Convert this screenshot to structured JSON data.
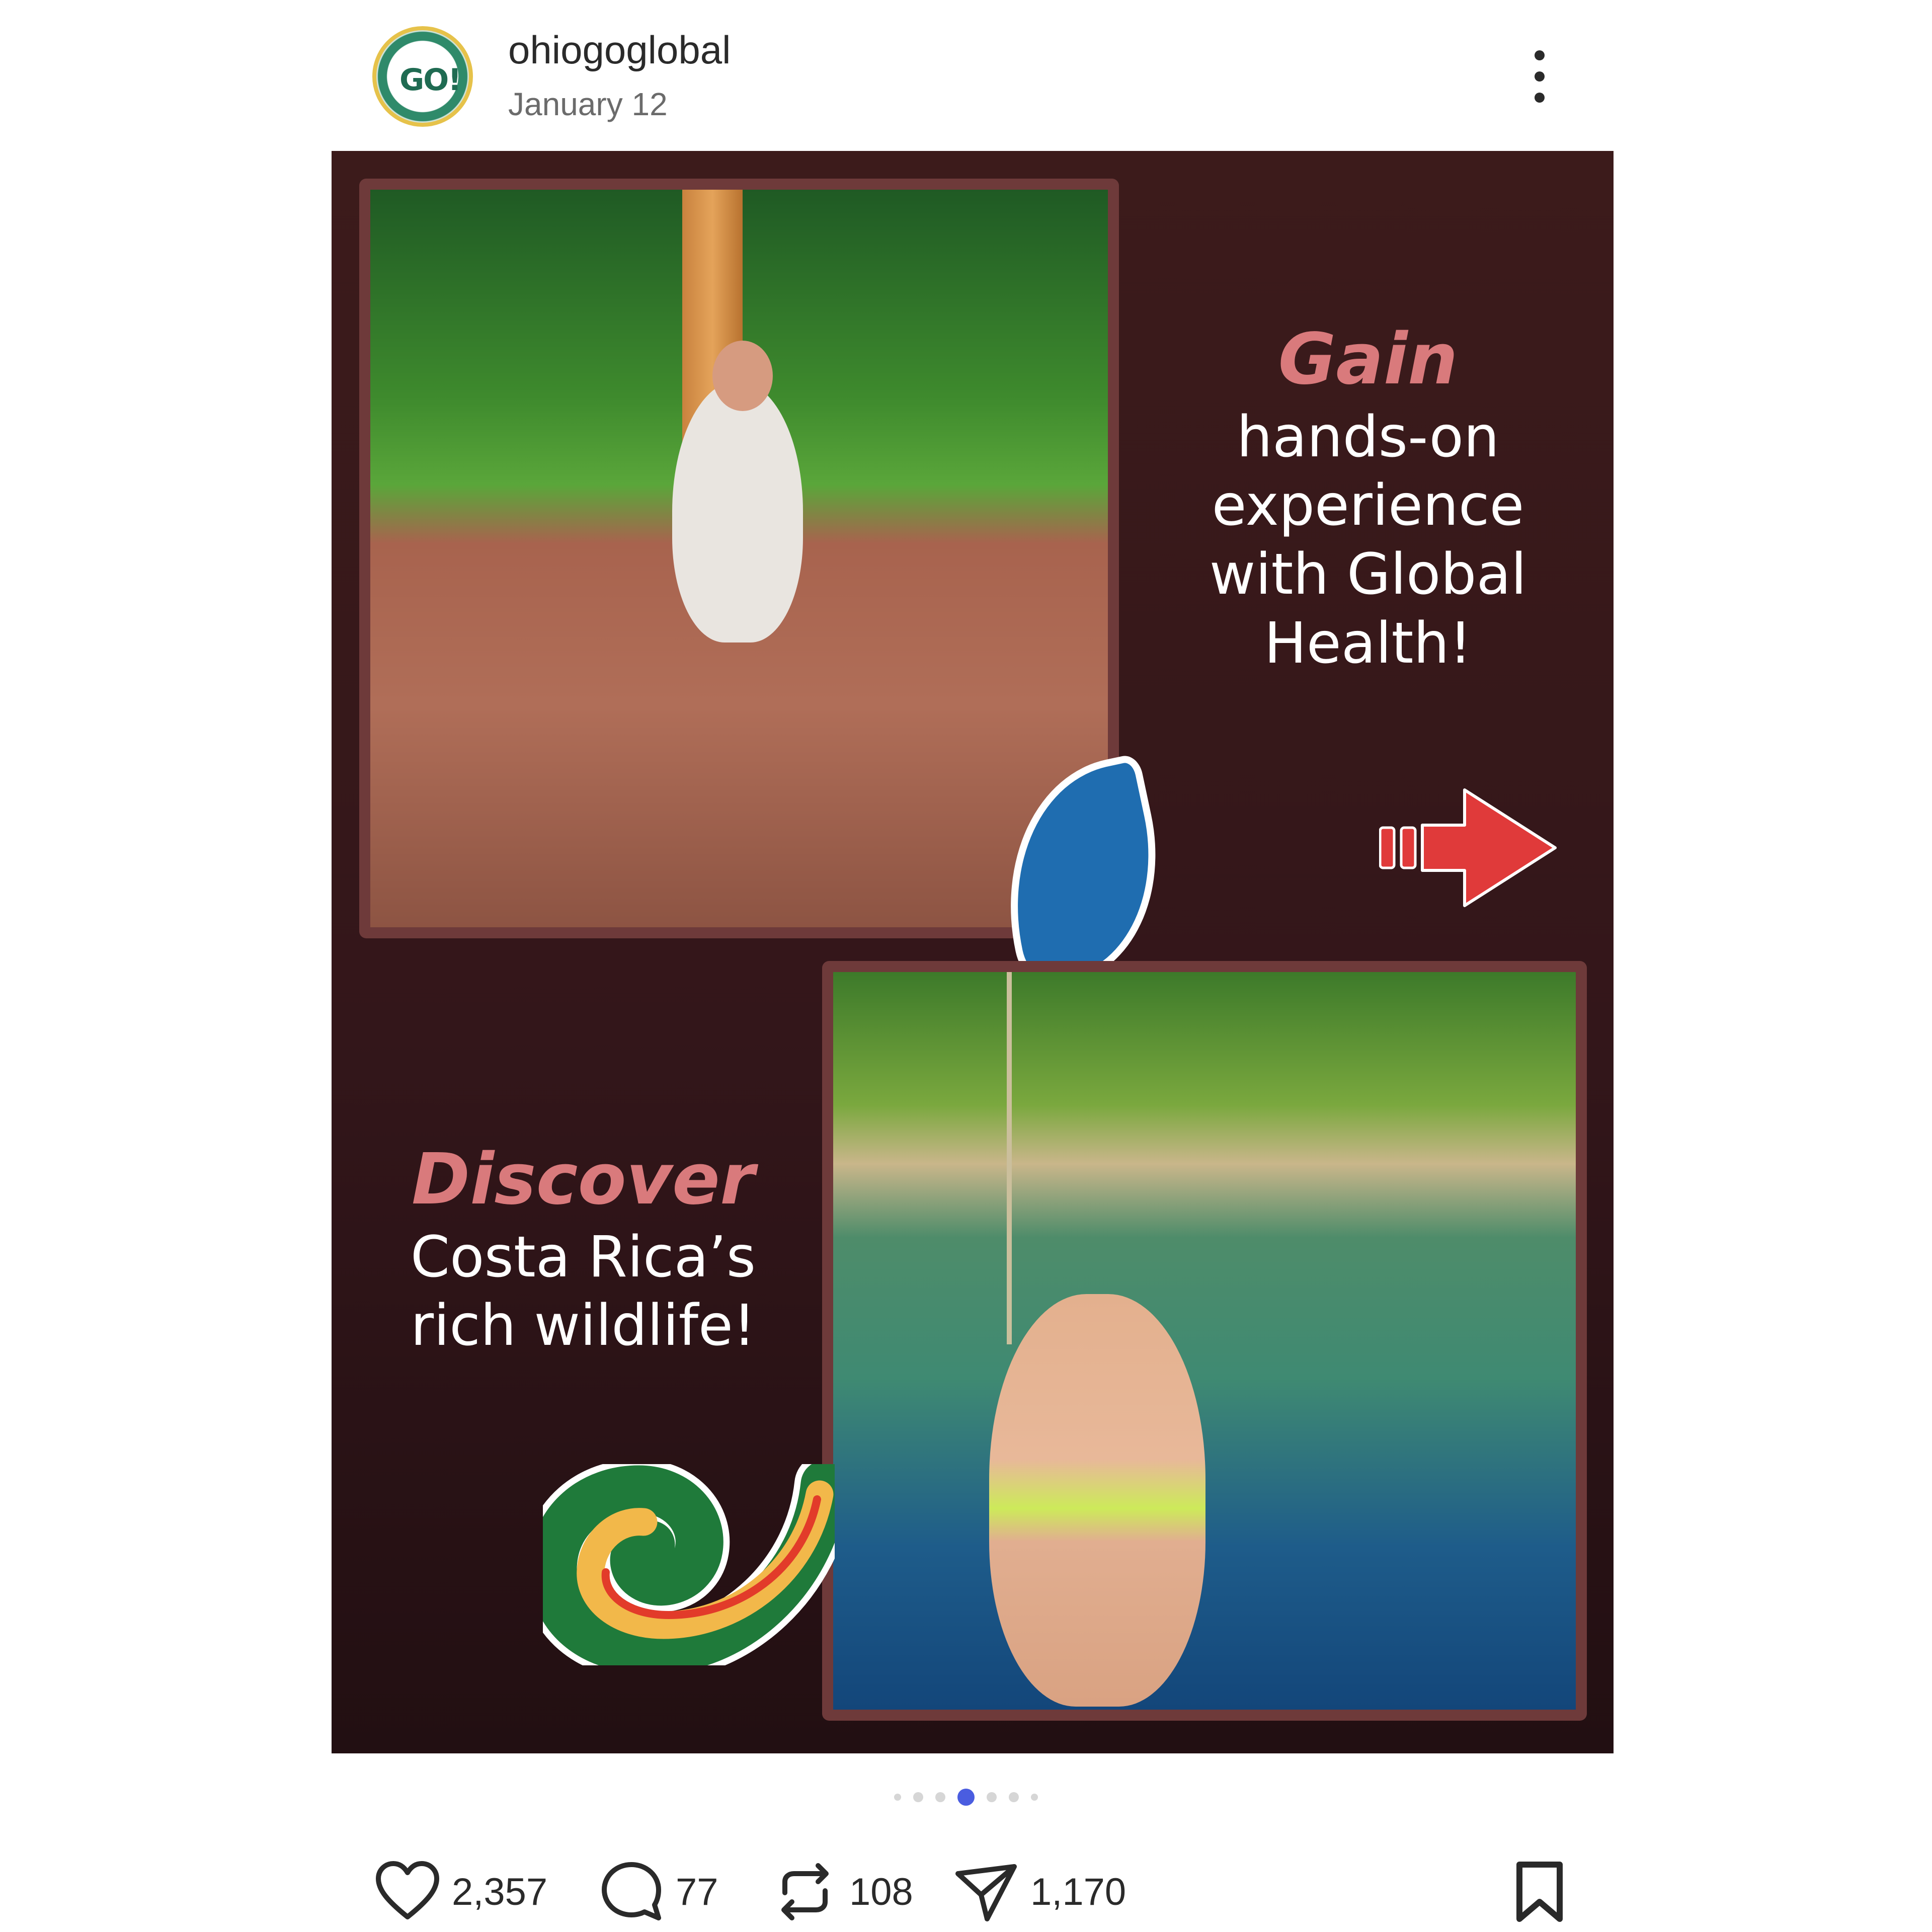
{
  "post": {
    "username": "ohiogoglobal",
    "date": "January 12",
    "avatar_text": "GO!"
  },
  "slide": {
    "headline1": {
      "accent": "Gain",
      "text": "hands-on experience with Global Health!"
    },
    "headline2": {
      "accent": "Discover",
      "text": "Costa Rica’s rich wildlife!"
    },
    "colors": {
      "background": "#3a1a1a",
      "frame": "#6e3a3a",
      "accent_text": "#d97a7c",
      "arrow": "#e03a3a"
    }
  },
  "carousel": {
    "total_dots": 7,
    "active_index": 3
  },
  "actions": {
    "likes": "2,357",
    "comments": "77",
    "reposts": "108",
    "shares": "1,170"
  },
  "icons": [
    "more-icon",
    "heart-icon",
    "comment-icon",
    "repost-icon",
    "share-icon",
    "bookmark-icon",
    "arrow-right-icon"
  ]
}
